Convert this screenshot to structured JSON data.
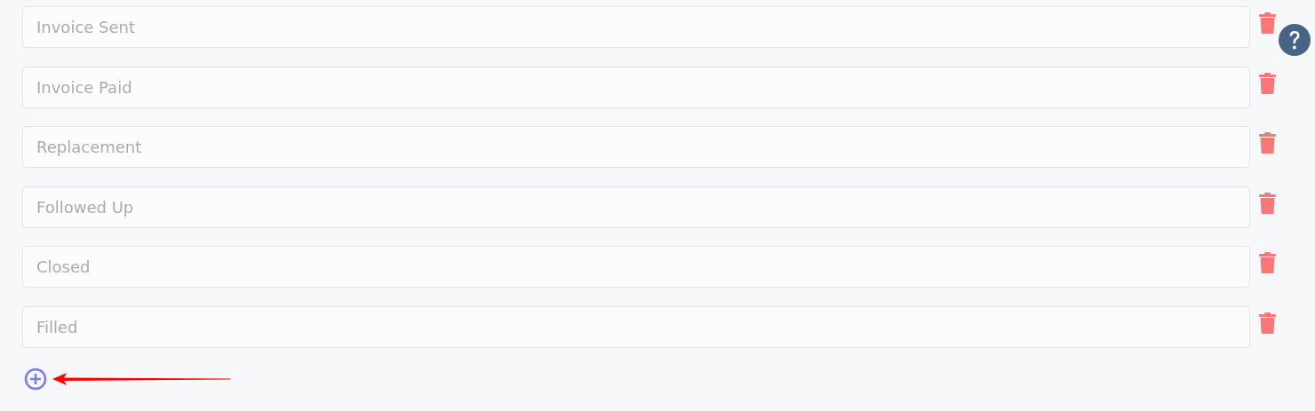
{
  "statuses": [
    {
      "placeholder": "Invoice Sent"
    },
    {
      "placeholder": "Invoice Paid"
    },
    {
      "placeholder": "Replacement"
    },
    {
      "placeholder": "Followed Up"
    },
    {
      "placeholder": "Closed"
    },
    {
      "placeholder": "Filled"
    }
  ]
}
